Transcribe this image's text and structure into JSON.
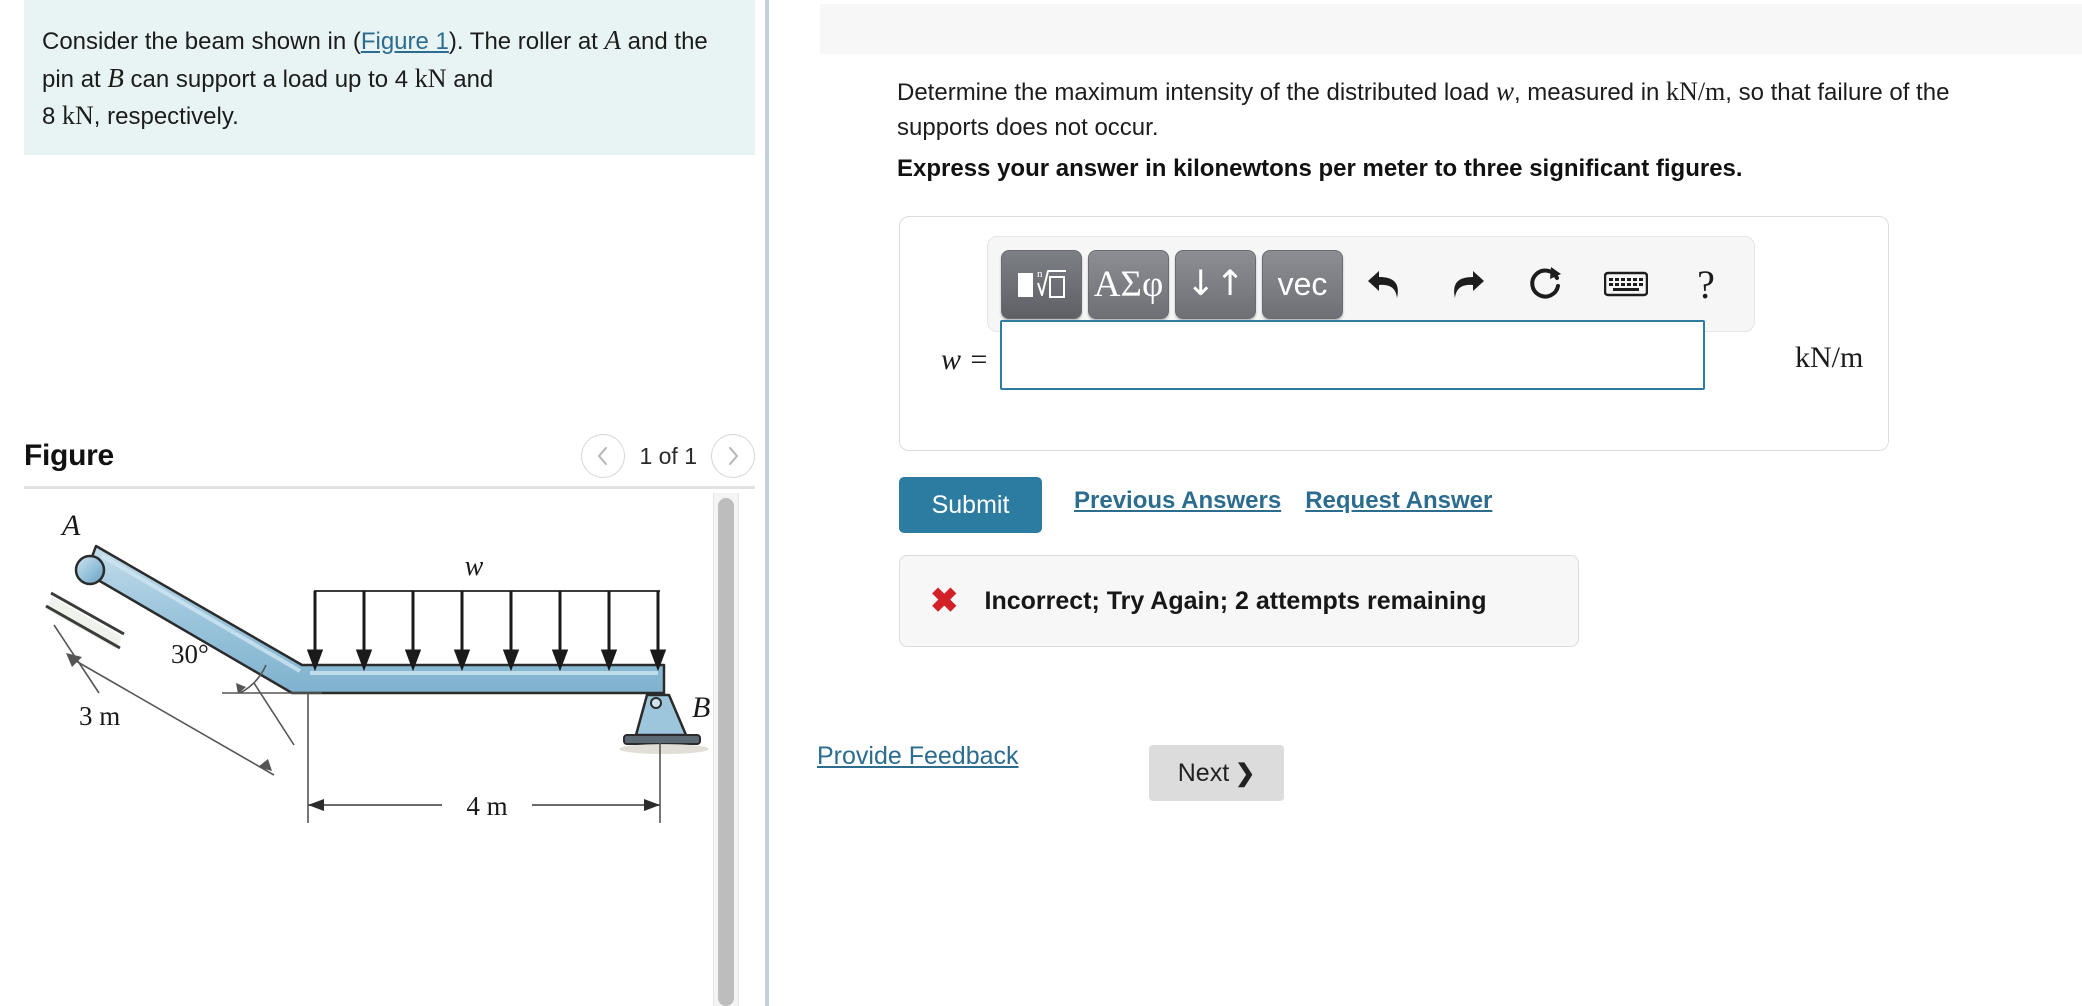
{
  "left": {
    "problem": {
      "line1_a": "Consider the beam shown in (",
      "figure_link": "Figure 1",
      "line1_b": "). The roller at ",
      "var_A": "A",
      "line2_a": " and the pin at ",
      "var_B": "B",
      "line2_b": " can support a load up to 4 ",
      "unit_kn_1": "kN",
      "line2_c": " and ",
      "line3_a": "8 ",
      "unit_kn_2": "kN",
      "line3_b": ", respectively."
    },
    "figure": {
      "title": "Figure",
      "prev_icon": "chevron-left-icon",
      "next_icon": "chevron-right-icon",
      "counter": "1 of 1",
      "labels": {
        "point_a": "A",
        "point_b": "B",
        "load_w": "w",
        "angle": "30°",
        "incline_length": "3 m",
        "horizontal_length": "4 m"
      },
      "arrow_count": 8
    }
  },
  "right": {
    "question": {
      "text_a": "Determine the maximum intensity of the distributed load ",
      "var_w": "w",
      "text_b": ", measured in ",
      "unit": "kN/m",
      "text_c": ", so that failure of the supports does not occur.",
      "express": "Express your answer in kilonewtons per meter to three significant figures."
    },
    "toolbar": {
      "template_button": "math-template-icon",
      "greek_button": "ΑΣφ",
      "arrows_button": "↓↑",
      "vec_button": "vec",
      "undo_icon": "undo-icon",
      "redo_icon": "redo-icon",
      "reset_icon": "reset-icon",
      "keyboard_icon": "keyboard-icon",
      "help_icon": "?"
    },
    "answer": {
      "var_label": "w =",
      "value": "",
      "placeholder": "",
      "units": "kN/m"
    },
    "actions": {
      "submit_label": "Submit",
      "previous_answers_label": "Previous Answers",
      "request_answer_label": "Request Answer"
    },
    "feedback": {
      "icon": "x-mark-icon",
      "message": "Incorrect; Try Again; 2 attempts remaining"
    },
    "footer": {
      "provide_feedback_label": "Provide Feedback",
      "next_label": "Next",
      "next_chevron": "❯"
    }
  },
  "colors": {
    "accent_blue": "#2c7ba0",
    "link_blue": "#2b6c8f",
    "problem_bg": "#e8f4f3",
    "error_red": "#d32027",
    "beam_blue": "#9dc6dd",
    "toolbar_grey": "#6e7076"
  }
}
